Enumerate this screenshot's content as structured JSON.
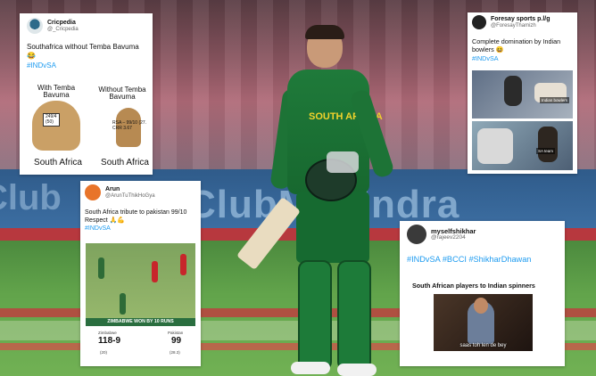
{
  "background": {
    "board_text": "ClubMahindra",
    "board_text_left": "Club",
    "player_chest": "SOUTH AFRICA"
  },
  "card1": {
    "name": "Cricpedia",
    "handle": "@_Cricpedia",
    "text": "Southafrica without Temba Bavuma",
    "emoji": "😂",
    "hashtag": "#INDvSA",
    "meme": {
      "left_top": "With Temba Bavuma",
      "right_top": "Without Temba Bavuma",
      "left_score_top": "249/4",
      "left_score_bottom": "(50)",
      "right_score_top": "RSA – 99/10 (27.",
      "right_score_bottom": "CRR  3.67",
      "left_bottom": "South Africa",
      "right_bottom": "South Africa"
    }
  },
  "card2": {
    "name": "Foresay sports p.l/g",
    "handle": "@ForesayThamizh",
    "text": "Complete domination by Indian bowlers",
    "emoji": "😆",
    "hashtag": "#INDvSA",
    "meme": {
      "label_top": "Indian bowlers",
      "label_bottom": "SA team"
    }
  },
  "card3": {
    "name": "Arun",
    "handle": "@ArunTuThikHoGya",
    "text": "South Africa tribute to pakistan 99/10 Respect",
    "emoji": "🙏💪",
    "hashtag": "#INDvSA",
    "meme": {
      "banner": "ZIMBABWE WON BY 10 RUNS",
      "team_left": "Zimbabwe",
      "score_left": "118-9",
      "overs_left": "(20)",
      "team_right": "Pakistan",
      "score_right": "99",
      "overs_right": "(28.3)"
    }
  },
  "card4": {
    "name": "myselfshikhar",
    "handle": "@rajeev2204",
    "hashtags": "#INDvSA  #BCCI  #ShikharDhawan",
    "meme_title": "South African players to Indian spinners",
    "meme_caption": "saas toh len de bey"
  },
  "colors": {
    "hashtag": "#1d9bf0",
    "jersey_green": "#1d7b39",
    "jersey_yellow": "#f2d32b"
  }
}
